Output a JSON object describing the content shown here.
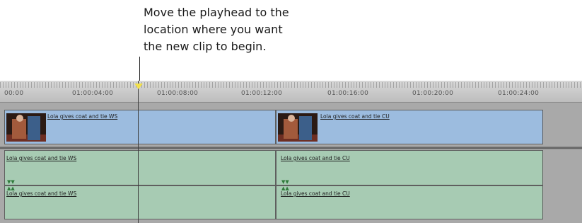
{
  "callout": {
    "line1": "Move the playhead to the",
    "line2": "location where you want",
    "line3": "the new clip to begin."
  },
  "ruler": {
    "timecodes": [
      "00:00",
      "01:00:04:00",
      "01:00:08:00",
      "01:00:12:00",
      "01:00:16:00",
      "01:00:20:00",
      "01:00:24:00"
    ]
  },
  "video_track": {
    "clips": [
      {
        "label": "Lola gives coat and tie WS"
      },
      {
        "label": "Lola gives coat and tie CU"
      }
    ]
  },
  "audio_track_1": {
    "clips": [
      {
        "label": "Lola gives coat and tie WS"
      },
      {
        "label": "Lola gives coat and tie CU"
      }
    ]
  },
  "audio_track_2": {
    "clips": [
      {
        "label": "Lola gives coat and tie WS"
      },
      {
        "label": "Lola gives coat and tie CU"
      }
    ]
  },
  "colors": {
    "video_clip": "#9cbcdf",
    "audio_clip": "#a7cbb3",
    "playhead_marker": "#f3e14a"
  }
}
